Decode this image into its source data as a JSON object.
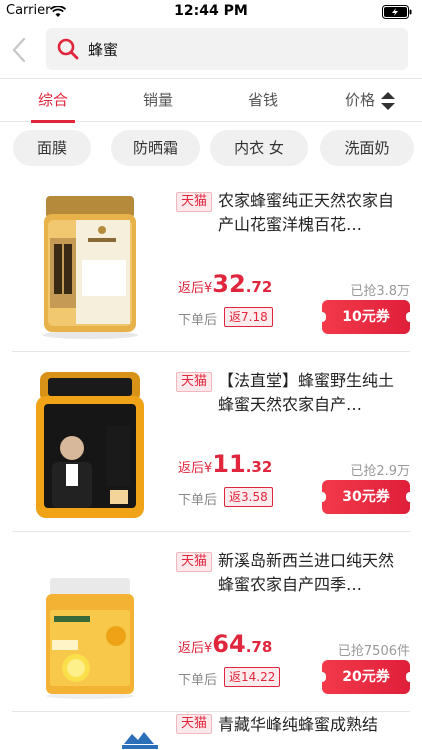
{
  "status_bar": {
    "carrier": "Carrier",
    "time": "12:44 PM"
  },
  "search": {
    "query": "蜂蜜"
  },
  "sort_tabs": [
    {
      "label": "综合"
    },
    {
      "label": "销量"
    },
    {
      "label": "省钱"
    },
    {
      "label": "价格"
    }
  ],
  "chips": [
    "面膜",
    "防晒霜",
    "内衣 女",
    "洗面奶"
  ],
  "products": [
    {
      "tag": "天猫",
      "title": "农家蜂蜜纯正天然农家自产山花蜜洋槐百花…",
      "price_label": "返后",
      "currency": "¥",
      "price_int": "32",
      "price_dec": ".72",
      "sold": "已抢3.8万",
      "after_order": "下单后",
      "rebate": "返7.18",
      "coupon": "10元券"
    },
    {
      "tag": "天猫",
      "title": "【法直堂】蜂蜜野生纯土蜂蜜天然农家自产…",
      "price_label": "返后",
      "currency": "¥",
      "price_int": "11",
      "price_dec": ".32",
      "sold": "已抢2.9万",
      "after_order": "下单后",
      "rebate": "返3.58",
      "coupon": "30元券"
    },
    {
      "tag": "天猫",
      "title": "新溪岛新西兰进口纯天然蜂蜜农家自产四季…",
      "price_label": "返后",
      "currency": "¥",
      "price_int": "64",
      "price_dec": ".78",
      "sold": "已抢7506件",
      "after_order": "下单后",
      "rebate": "返14.22",
      "coupon": "20元券"
    },
    {
      "tag": "天猫",
      "title": "青藏华峰纯蜂蜜成熟结"
    }
  ],
  "colors": {
    "accent": "#e0263c"
  }
}
